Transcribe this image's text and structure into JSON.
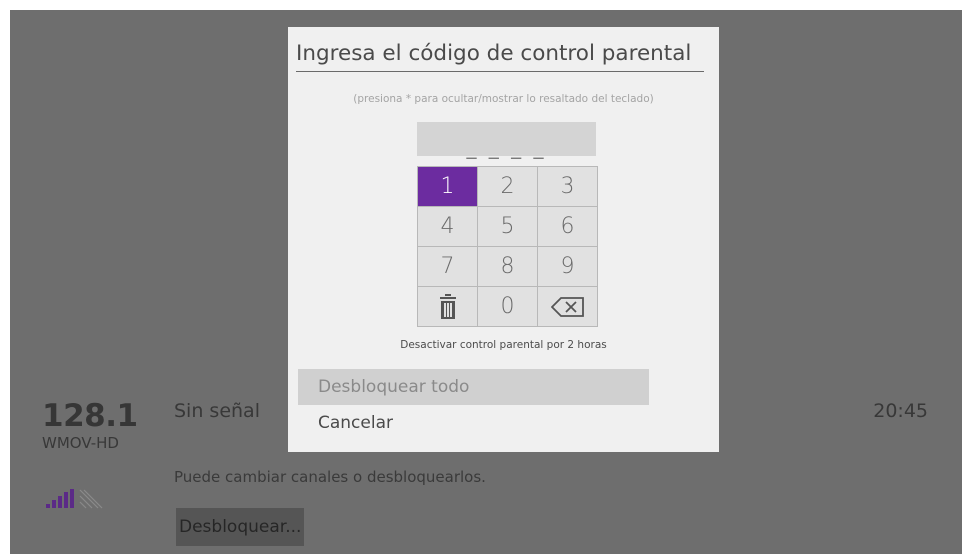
{
  "channel": {
    "number": "128.1",
    "name": "WMOV-HD",
    "status": "Sin señal",
    "time": "20:45",
    "hint": "Puede cambiar canales o desbloquearlos.",
    "unlock_label": "Desbloquear...",
    "signal_icon": "signal-strength-icon",
    "antenna_icon": "antenna-off-icon"
  },
  "dialog": {
    "title": "Ingresa el código de control parental",
    "hint": "(presiona * para ocultar/mostrar lo resaltado del teclado)",
    "code_placeholder": "_ _ _ _",
    "keys": [
      "1",
      "2",
      "3",
      "4",
      "5",
      "6",
      "7",
      "8",
      "9",
      "",
      "0",
      ""
    ],
    "trash_icon": "trash-icon",
    "backspace_icon": "backspace-icon",
    "disable_label": "Desactivar control parental por 2 horas",
    "menu": [
      {
        "label": "Desbloquear todo"
      },
      {
        "label": "Cancelar"
      }
    ]
  },
  "colors": {
    "accent": "#6c2ca0",
    "overlay": "#6e6e6e",
    "dialog_bg": "#f0f0f0"
  }
}
